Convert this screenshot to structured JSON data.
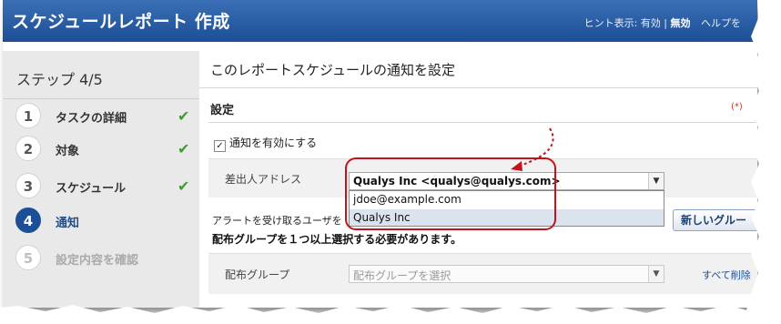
{
  "window": {
    "title": "スケジュールレポート 作成",
    "hint_label": "ヒント表示: 有効 |",
    "hint_off": "無効",
    "help": "ヘルプを"
  },
  "sidebar": {
    "step_title": "ステップ 4/5",
    "steps": [
      {
        "num": "1",
        "label": "タスクの詳細",
        "done": true
      },
      {
        "num": "2",
        "label": "対象",
        "done": true
      },
      {
        "num": "3",
        "label": "スケジュール",
        "done": true
      },
      {
        "num": "4",
        "label": "通知",
        "active": true
      },
      {
        "num": "5",
        "label": "設定内容を確認",
        "disabled": true
      }
    ],
    "check_glyph": "✔"
  },
  "main": {
    "heading": "このレポートスケジュールの通知を設定",
    "section_title": "設定",
    "required_marker": "(*)",
    "enable_label": "通知を有効にする",
    "enable_checked": true,
    "sender_label": "差出人アドレス",
    "sender_value": "Qualys Inc <qualys@qualys.com>",
    "sender_options": [
      "jdoe@example.com",
      "Qualys Inc"
    ],
    "alert_text": "アラートを受け取るユーザを",
    "new_group_button": "新しいグルー",
    "required_message": "配布グループを１つ以上選択する必要があります。",
    "dist_label": "配布グループ",
    "dist_placeholder": "配布グループを選択",
    "select_all": "すべて削除"
  },
  "colors": {
    "titlebar": "#1c4f95",
    "accent": "#1d4f96",
    "callout": "#c0141a",
    "check": "#3f9d2f"
  }
}
